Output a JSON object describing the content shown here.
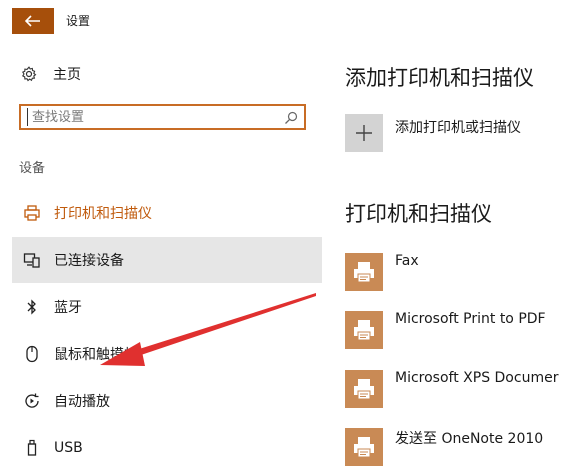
{
  "window": {
    "title": "设置",
    "back_icon": "back-arrow-icon",
    "accent": "#a64f0b"
  },
  "sidebar": {
    "home_label": "主页",
    "search_placeholder": "查找设置",
    "section_label": "设备",
    "items": [
      {
        "label": "打印机和扫描仪",
        "icon": "printer-icon",
        "state": "selected"
      },
      {
        "label": "已连接设备",
        "icon": "connected-devices-icon",
        "state": "hover"
      },
      {
        "label": "蓝牙",
        "icon": "bluetooth-icon",
        "state": "normal"
      },
      {
        "label": "鼠标和触摸板",
        "icon": "mouse-icon",
        "state": "normal"
      },
      {
        "label": "自动播放",
        "icon": "autoplay-icon",
        "state": "normal"
      },
      {
        "label": "USB",
        "icon": "usb-icon",
        "state": "normal"
      }
    ]
  },
  "main": {
    "add_heading": "添加打印机和扫描仪",
    "add_button_label": "添加打印机或扫描仪",
    "list_heading": "打印机和扫描仪",
    "printers": [
      {
        "name": "Fax"
      },
      {
        "name": "Microsoft Print to PDF"
      },
      {
        "name": "Microsoft XPS Documer"
      },
      {
        "name": "发送至 OneNote 2010"
      }
    ]
  },
  "annotation": {
    "type": "red-arrow",
    "color": "#e0302f"
  }
}
